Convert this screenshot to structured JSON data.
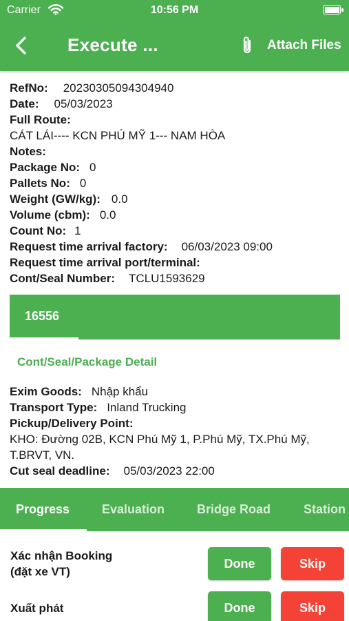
{
  "status": {
    "carrier": "Carrier",
    "time": "10:56 PM",
    "battery_level": 1.0
  },
  "appbar": {
    "title": "Execute ...",
    "attach_label": "Attach Files",
    "back_icon": "chevron-left-icon",
    "attach_icon": "paperclip-icon"
  },
  "details": {
    "refno_k": "RefNo:",
    "refno_v": "20230305094304940",
    "date_k": "Date:",
    "date_v": "05/03/2023",
    "route_k": "Full Route:",
    "route_v": "CÁT LÁI---- KCN PHÚ MỸ 1--- NAM HÒA",
    "notes_k": "Notes:",
    "package_k": "Package No:",
    "package_v": "0",
    "pallets_k": "Pallets No:",
    "pallets_v": "0",
    "weight_k": "Weight (GW/kg):",
    "weight_v": "0.0",
    "volume_k": "Volume (cbm):",
    "volume_v": "0.0",
    "count_k": "Count No:",
    "count_v": "1",
    "rta_factory_k": "Request time arrival factory:",
    "rta_factory_v": "06/03/2023 09:00",
    "rta_port_k": "Request time arrival port/terminal:",
    "seal_k": "Cont/Seal Number:",
    "seal_v": "TCLU1593629"
  },
  "cont_tab": {
    "number": "16556"
  },
  "detail_link": "Cont/Seal/Package Detail",
  "details2": {
    "exim_k": "Exim Goods:",
    "exim_v": "Nhập khẩu",
    "transport_k": "Transport Type:",
    "transport_v": "Inland Trucking",
    "pickup_k": "Pickup/Delivery Point:",
    "pickup_v": "KHO: Đường 02B, KCN Phú Mỹ 1, P.Phú Mỹ, TX.Phú Mỹ, T.BRVT, VN.",
    "cutseal_k": "Cut seal deadline:",
    "cutseal_v": "05/03/2023 22:00"
  },
  "tabs": [
    "Progress",
    "Evaluation",
    "Bridge Road",
    "Station"
  ],
  "steps": [
    {
      "label_line1": "Xác nhận Booking",
      "label_line2": "(đặt xe VT)",
      "done": "Done",
      "skip": "Skip"
    },
    {
      "label_line1": "Xuất phát",
      "done": "Done",
      "skip": "Skip"
    }
  ],
  "colors": {
    "primary": "#4caf50",
    "danger": "#f44336"
  }
}
